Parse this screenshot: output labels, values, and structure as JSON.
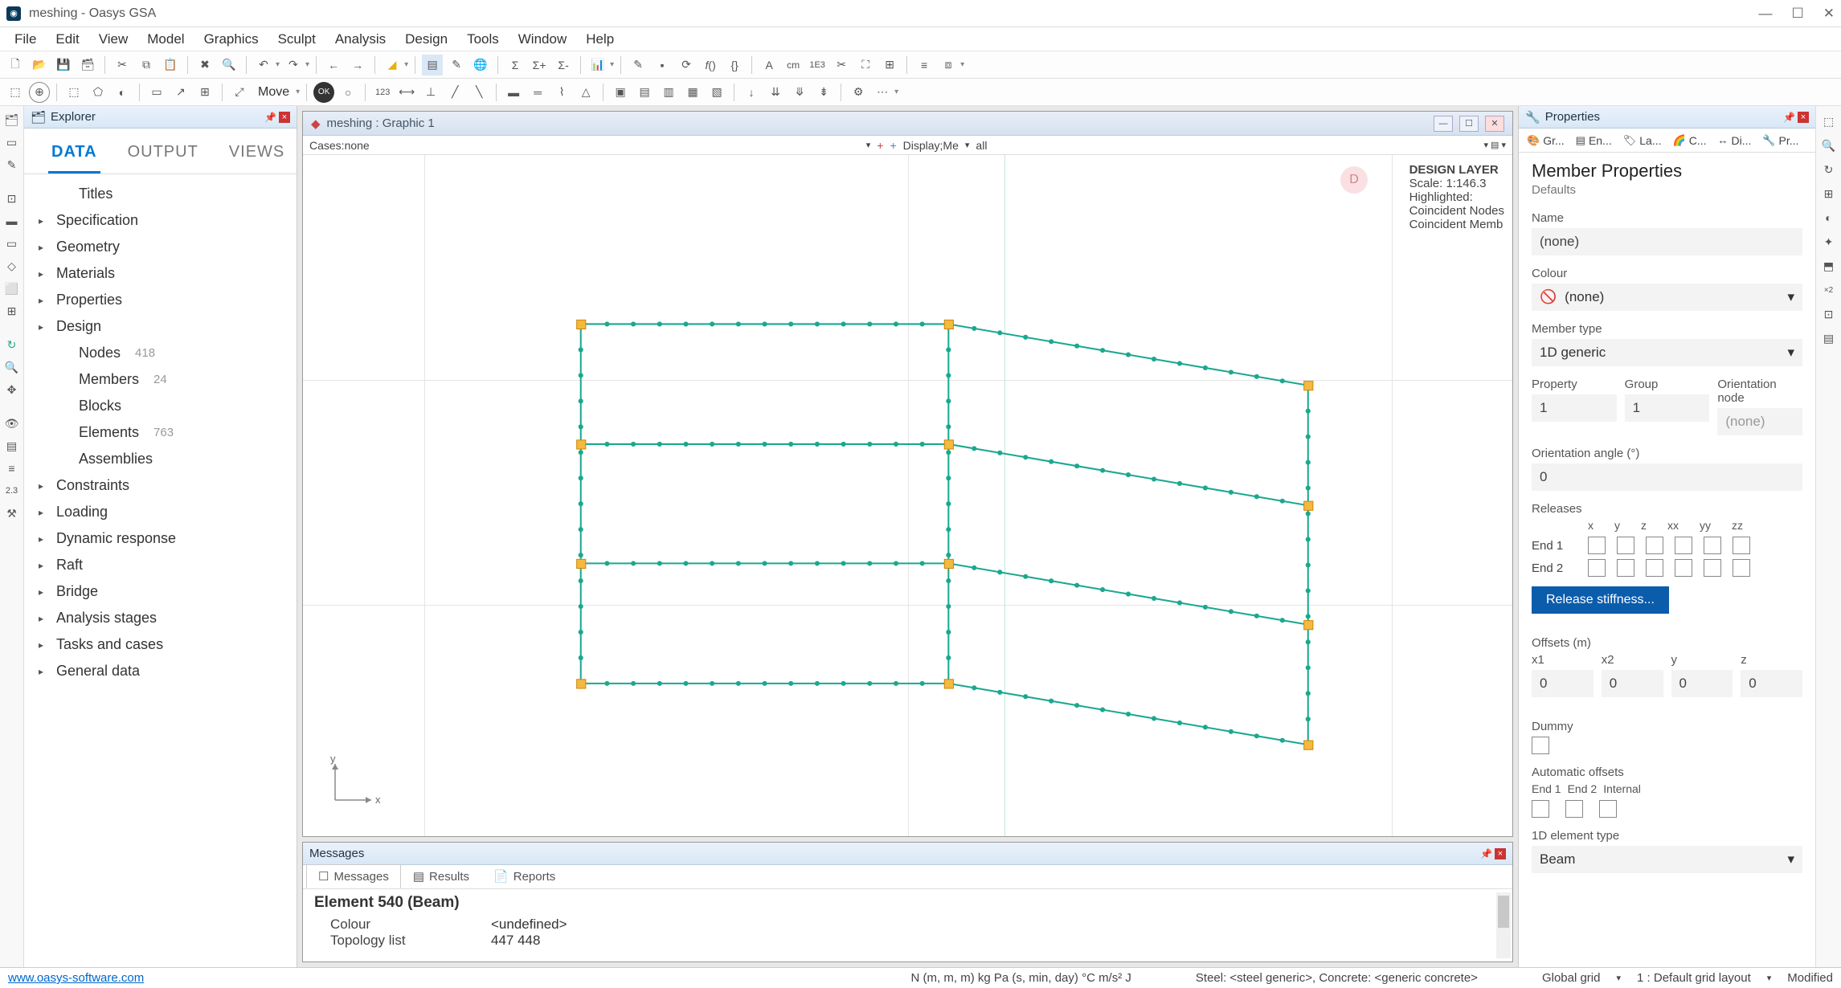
{
  "window": {
    "title": "meshing - Oasys GSA"
  },
  "menu": [
    "File",
    "Edit",
    "View",
    "Model",
    "Graphics",
    "Sculpt",
    "Analysis",
    "Design",
    "Tools",
    "Window",
    "Help"
  ],
  "toolbar2": {
    "move_label": "Move"
  },
  "explorer": {
    "title": "Explorer",
    "tabs": [
      "DATA",
      "OUTPUT",
      "VIEWS"
    ],
    "active_tab": "DATA",
    "items": [
      {
        "label": "Titles",
        "leaf": true
      },
      {
        "label": "Specification"
      },
      {
        "label": "Geometry"
      },
      {
        "label": "Materials"
      },
      {
        "label": "Properties"
      },
      {
        "label": "Design"
      },
      {
        "label": "Nodes",
        "leaf": true,
        "count": "418"
      },
      {
        "label": "Members",
        "leaf": true,
        "count": "24"
      },
      {
        "label": "Blocks",
        "leaf": true
      },
      {
        "label": "Elements",
        "leaf": true,
        "count": "763"
      },
      {
        "label": "Assemblies",
        "leaf": true
      },
      {
        "label": "Constraints"
      },
      {
        "label": "Loading"
      },
      {
        "label": "Dynamic response"
      },
      {
        "label": "Raft"
      },
      {
        "label": "Bridge"
      },
      {
        "label": "Analysis stages"
      },
      {
        "label": "Tasks and cases"
      },
      {
        "label": "General data"
      }
    ]
  },
  "graphic": {
    "tab_title": "meshing : Graphic 1",
    "cases_label": "Cases:none",
    "display_label": "Display;Me",
    "all_label": "all",
    "overlay": {
      "layer": "DESIGN LAYER",
      "scale": "Scale: 1:146.3",
      "highlighted": "Highlighted:",
      "line1": "Coincident Nodes",
      "line2": "Coincident Memb"
    },
    "d_badge": "D",
    "axes": {
      "x": "x",
      "y": "y"
    }
  },
  "messages": {
    "title": "Messages",
    "tabs": [
      "Messages",
      "Results",
      "Reports"
    ],
    "heading": "Element 540 (Beam)",
    "rows": [
      {
        "k": "Colour",
        "v": "<undefined>"
      },
      {
        "k": "Topology list",
        "v": "447 448"
      }
    ]
  },
  "properties": {
    "title": "Properties",
    "tabs": [
      "Gr...",
      "En...",
      "La...",
      "C...",
      "Di...",
      "Pr..."
    ],
    "heading": "Member Properties",
    "sub": "Defaults",
    "name_label": "Name",
    "name_value": "(none)",
    "colour_label": "Colour",
    "colour_value": "(none)",
    "member_type_label": "Member type",
    "member_type_value": "1D generic",
    "property_label": "Property",
    "property_value": "1",
    "group_label": "Group",
    "group_value": "1",
    "orient_node_label": "Orientation node",
    "orient_node_value": "(none)",
    "orient_angle_label": "Orientation angle (°)",
    "orient_angle_value": "0",
    "releases_label": "Releases",
    "release_axes": [
      "x",
      "y",
      "z",
      "xx",
      "yy",
      "zz"
    ],
    "end1": "End 1",
    "end2": "End 2",
    "release_btn": "Release stiffness...",
    "offsets_label": "Offsets (m)",
    "offset_labels": [
      "x1",
      "x2",
      "y",
      "z"
    ],
    "offset_values": [
      "0",
      "0",
      "0",
      "0"
    ],
    "dummy_label": "Dummy",
    "auto_offsets_label": "Automatic offsets",
    "auto_offsets_sub": [
      "End 1",
      "End 2",
      "Internal"
    ],
    "elem_type_label": "1D element type",
    "elem_type_value": "Beam"
  },
  "status": {
    "link": "www.oasys-software.com",
    "units": "N  (m, m, m)  kg  Pa  (s, min, day)  °C  m/s²  J",
    "materials": "Steel: <steel generic>, Concrete: <generic concrete>",
    "grid": "Global grid",
    "layout": "1 : Default grid layout",
    "modified": "Modified"
  }
}
